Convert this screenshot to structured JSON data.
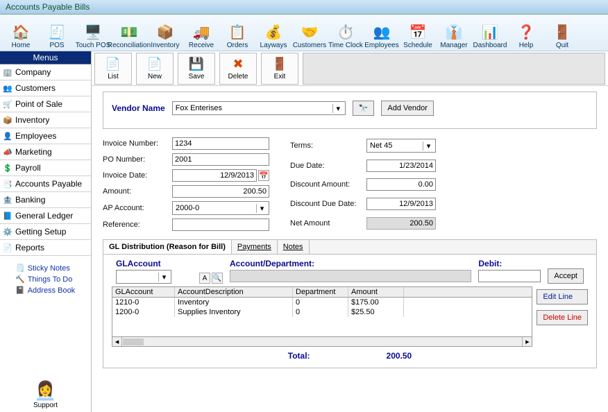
{
  "window": {
    "title": "Accounts Payable Bills"
  },
  "toolbar": [
    {
      "label": "Home",
      "icon": "🏠"
    },
    {
      "label": "POS",
      "icon": "🧾"
    },
    {
      "label": "Touch POS",
      "icon": "🖥️"
    },
    {
      "label": "Reconciliation",
      "icon": "💵"
    },
    {
      "label": "Inventory",
      "icon": "📦"
    },
    {
      "label": "Receive",
      "icon": "🚚"
    },
    {
      "label": "Orders",
      "icon": "📋"
    },
    {
      "label": "Layways",
      "icon": "💰"
    },
    {
      "label": "Customers",
      "icon": "🤝"
    },
    {
      "label": "Time Clock",
      "icon": "⏱️"
    },
    {
      "label": "Employees",
      "icon": "👥"
    },
    {
      "label": "Schedule",
      "icon": "📅"
    },
    {
      "label": "Manager",
      "icon": "👔"
    },
    {
      "label": "Dashboard",
      "icon": "📊"
    },
    {
      "label": "Help",
      "icon": "❓"
    },
    {
      "label": "Quit",
      "icon": "🚪"
    }
  ],
  "subtoolbar": [
    {
      "label": "List",
      "icon": "📄"
    },
    {
      "label": "New",
      "icon": "📄"
    },
    {
      "label": "Save",
      "icon": "💾"
    },
    {
      "label": "Delete",
      "icon": "✖"
    },
    {
      "label": "Exit",
      "icon": "🚪"
    }
  ],
  "side": {
    "header": "Menus",
    "items": [
      {
        "label": "Company",
        "icon": "🏢"
      },
      {
        "label": "Customers",
        "icon": "👥"
      },
      {
        "label": "Point of Sale",
        "icon": "🛒"
      },
      {
        "label": "Inventory",
        "icon": "📦"
      },
      {
        "label": "Employees",
        "icon": "👤"
      },
      {
        "label": "Marketing",
        "icon": "📣"
      },
      {
        "label": "Payroll",
        "icon": "💲"
      },
      {
        "label": "Accounts Payable",
        "icon": "📑"
      },
      {
        "label": "Banking",
        "icon": "🏦"
      },
      {
        "label": "General Ledger",
        "icon": "📘"
      },
      {
        "label": "Getting Setup",
        "icon": "⚙️"
      },
      {
        "label": "Reports",
        "icon": "📄"
      }
    ],
    "subs": [
      {
        "label": "Sticky Notes",
        "icon": "🗒️"
      },
      {
        "label": "Things To Do",
        "icon": "🔨"
      },
      {
        "label": "Address Book",
        "icon": "📓"
      }
    ],
    "support": "Support"
  },
  "vendor": {
    "label": "Vendor Name",
    "value": "Fox Enterises",
    "add_label": "Add Vendor"
  },
  "left_fields": {
    "invoice_number": {
      "label": "Invoice Number:",
      "value": "1234"
    },
    "po_number": {
      "label": "PO Number:",
      "value": "2001"
    },
    "invoice_date": {
      "label": "Invoice Date:",
      "value": "12/9/2013"
    },
    "amount": {
      "label": "Amount:",
      "value": "200.50"
    },
    "ap_account": {
      "label": "AP Account:",
      "value": "2000-0"
    },
    "reference": {
      "label": "Reference:",
      "value": ""
    }
  },
  "right_fields": {
    "terms": {
      "label": "Terms:",
      "value": "Net 45"
    },
    "due_date": {
      "label": "Due Date:",
      "value": "1/23/2014"
    },
    "discount_amount": {
      "label": "Discount Amount:",
      "value": "0.00"
    },
    "discount_due_date": {
      "label": "Discount Due Date:",
      "value": "12/9/2013"
    },
    "net_amount": {
      "label": "Net Amount",
      "value": "200.50"
    }
  },
  "tabs": {
    "t0": "GL Distribution (Reason for Bill)",
    "t1": "Payments",
    "t2": "Notes"
  },
  "dist": {
    "h_account": "GLAccount",
    "h_acctdept": "Account/Department:",
    "h_debit": "Debit:",
    "accept": "Accept",
    "edit": "Edit Line",
    "delete": "Delete Line",
    "cols": {
      "c1": "GLAccount",
      "c2": "AccountDescription",
      "c3": "Department",
      "c4": "Amount"
    },
    "rows": [
      {
        "acct": "1210-0",
        "desc": "Inventory",
        "dept": "0",
        "amt": "$175.00"
      },
      {
        "acct": "1200-0",
        "desc": "Supplies Inventory",
        "dept": "0",
        "amt": "$25.50"
      }
    ],
    "total_label": "Total:",
    "total_value": "200.50"
  }
}
